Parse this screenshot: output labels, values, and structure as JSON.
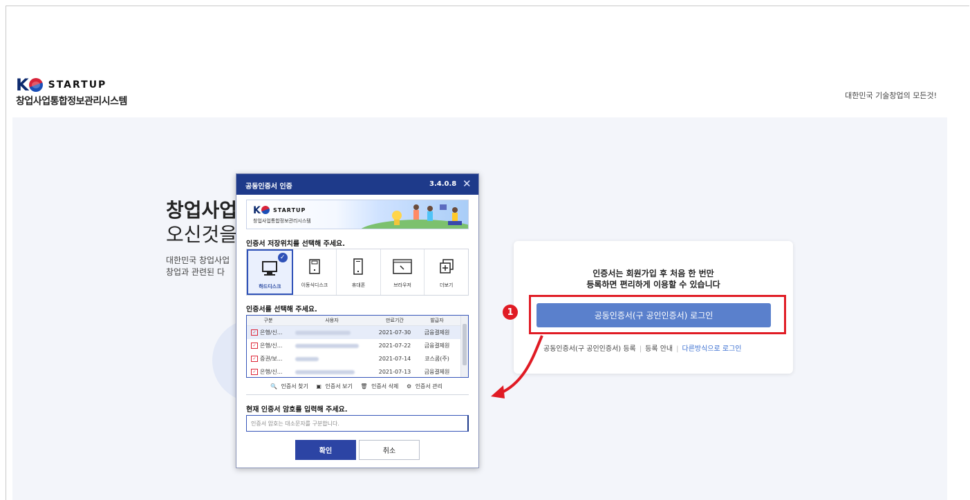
{
  "header": {
    "logo_k": "K",
    "logo_brand": "STARTUP",
    "logo_sub": "창업사업통합정보관리시스템",
    "slogan": "대한민국 기술창업의 모든것!"
  },
  "hero": {
    "title1": "창업사업",
    "title2": "오신것을",
    "desc1": "대한민국 창업사업",
    "desc2": "창업과 관련된 다"
  },
  "login_card": {
    "message_line1": "인증서는 회원가입 후 처음 한 번만",
    "message_line2": "등록하면 편리하게 이용할 수 있습니다",
    "login_button": "공동인증서(구 공인인증서) 로그인",
    "link_register": "공동인증서(구 공인인증서) 등록",
    "link_guide": "등록 안내",
    "link_other": "다른방식으로 로그인",
    "step_badge": "1",
    "highlight_color": "#e01b24"
  },
  "dialog": {
    "title": "공동인증서 인증",
    "version": "3.4.0.8",
    "close": "X",
    "banner": {
      "k": "K",
      "brand": "STARTUP",
      "sub": "창업사업통합정보관리시스템"
    },
    "storage_label": "인증서 저장위치를 선택해 주세요.",
    "storage_items": [
      {
        "label": "하드디스크",
        "icon": "hard-disk-icon",
        "selected": true
      },
      {
        "label": "이동식디스크",
        "icon": "removable-disk-icon",
        "selected": false
      },
      {
        "label": "휴대폰",
        "icon": "mobile-phone-icon",
        "selected": false
      },
      {
        "label": "브라우저",
        "icon": "browser-icon",
        "selected": false
      },
      {
        "label": "더보기",
        "icon": "more-icon",
        "selected": false
      }
    ],
    "cert_label": "인증서를 선택해 주세요.",
    "columns": [
      "구분",
      "사용자",
      "만료기간",
      "발급자"
    ],
    "rows": [
      {
        "type": "은행/신...",
        "expires": "2021-07-30",
        "issuer": "금융결제원",
        "selected": true
      },
      {
        "type": "은행/신...",
        "expires": "2021-07-22",
        "issuer": "금융결제원",
        "selected": false
      },
      {
        "type": "증권/보...",
        "expires": "2021-07-14",
        "issuer": "코스콤(주)",
        "selected": false
      },
      {
        "type": "은행/신...",
        "expires": "2021-07-13",
        "issuer": "금융결제원",
        "selected": false
      }
    ],
    "tools": [
      "인증서 찾기",
      "인증서 보기",
      "인증서 삭제",
      "인증서 관리"
    ],
    "password_label": "현재 인증서 암호를 입력해 주세요.",
    "password_placeholder": "인증서 암호는 대소문자를 구분합니다.",
    "ok": "확인",
    "cancel": "취소",
    "header_color": "#1e3a8a"
  }
}
